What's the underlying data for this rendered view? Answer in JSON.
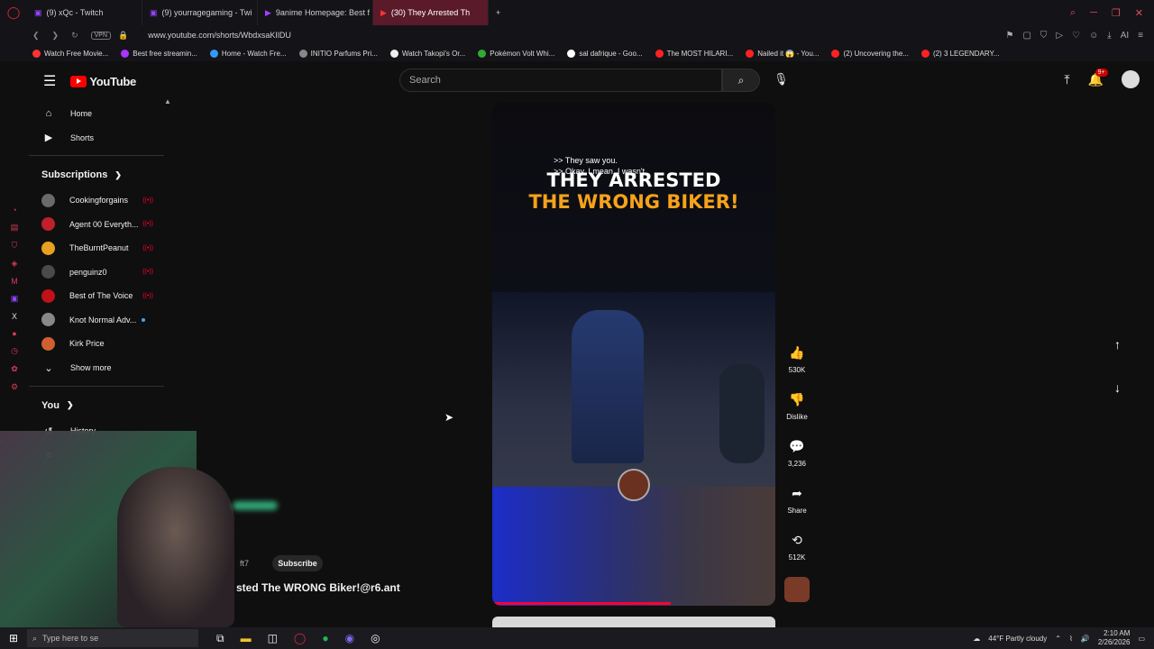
{
  "tabs": [
    {
      "label": "(9) xQc - Twitch",
      "icon": "twitch-icon"
    },
    {
      "label": "(9) yourragegaming - Twi",
      "icon": "twitch-icon"
    },
    {
      "label": "9anime Homepage: Best f",
      "icon": "play-icon"
    },
    {
      "label": "(30) They Arrested Th",
      "icon": "youtube-icon",
      "active": true
    }
  ],
  "address": {
    "vpn": "VPN",
    "url": "www.youtube.com/shorts/WbdxsaKIlDU"
  },
  "bookmarks": [
    "Watch Free Movie...",
    "Best free streamin...",
    "Home - Watch Fre...",
    "INITIO Parfums Pri...",
    "Watch Takopi's Or...",
    "Pokémon Volt Whi...",
    "sal dafrique - Goo...",
    "The MOST HILARI...",
    "Nailed it 😱 - You...",
    "(2) Uncovering the...",
    "(2) 3 LEGENDARY..."
  ],
  "header": {
    "logo": "YouTube",
    "search_placeholder": "Search",
    "badge": "9+"
  },
  "sidebar": {
    "home": "Home",
    "shorts": "Shorts",
    "subscriptions": "Subscriptions",
    "subs": [
      {
        "name": "Cookingforgains",
        "status": "live",
        "color": "#6a6a6a"
      },
      {
        "name": "Agent 00 Everyth...",
        "status": "live",
        "color": "#c0202a"
      },
      {
        "name": "TheBurntPeanut",
        "status": "live",
        "color": "#e8a020"
      },
      {
        "name": "penguinz0",
        "status": "live",
        "color": "#4a4a4a"
      },
      {
        "name": "Best of The Voice",
        "status": "live",
        "color": "#c01018"
      },
      {
        "name": "Knot Normal Adv...",
        "status": "new",
        "color": "#888"
      },
      {
        "name": "Kirk Price",
        "status": "",
        "color": "#d06030"
      }
    ],
    "show_more": "Show more",
    "you": "You",
    "history": "History"
  },
  "video": {
    "caption1": ">> They saw you.",
    "caption2": ">> Okay, I mean, I wasn't",
    "title1": "THEY ARRESTED",
    "title2": "THE WRONG BIKER!",
    "progress": 0.63
  },
  "actions": {
    "likes": "530K",
    "dislike": "Dislike",
    "comments": "3,236",
    "share": "Share",
    "remix": "512K"
  },
  "overlay": {
    "handle": "ft7",
    "subscribe": "Subscribe",
    "video_title": "sted The WRONG Biker!@r6.ant"
  },
  "taskbar": {
    "search": "Type here to se",
    "weather": "44°F  Partly cloudy",
    "time": "2:10 AM",
    "date": "2/26/2026"
  }
}
